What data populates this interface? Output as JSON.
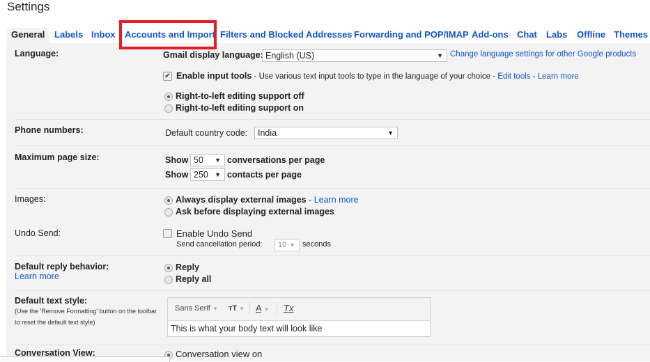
{
  "page": {
    "title": "Settings"
  },
  "tabs": [
    {
      "label": "General",
      "active": true
    },
    {
      "label": "Labels"
    },
    {
      "label": "Inbox"
    },
    {
      "label": "Accounts and Import",
      "highlighted": true
    },
    {
      "label": "Filters and Blocked Addresses"
    },
    {
      "label": "Forwarding and POP/IMAP"
    },
    {
      "label": "Add-ons"
    },
    {
      "label": "Chat"
    },
    {
      "label": "Labs"
    },
    {
      "label": "Offline"
    },
    {
      "label": "Themes"
    }
  ],
  "highlight_color": "#e41c24",
  "language": {
    "label": "Language:",
    "display_language_label": "Gmail display language:",
    "display_language_value": "English (US)",
    "change_link": "Change language settings for other Google products",
    "input_tools_checked": true,
    "input_tools_label": "Enable input tools",
    "input_tools_desc": " - Use various text input tools to type in the language of your choice - ",
    "edit_tools_link": "Edit tools",
    "dash": " - ",
    "learn_more_link": "Learn more",
    "rtl_options": [
      {
        "label": "Right-to-left editing support off",
        "selected": true
      },
      {
        "label": "Right-to-left editing support on",
        "selected": false
      }
    ]
  },
  "phone": {
    "label": "Phone numbers:",
    "country_code_label": "Default country code:",
    "country_code_value": "India"
  },
  "page_size": {
    "label": "Maximum page size:",
    "show_label": "Show",
    "conversations_value": "50",
    "conversations_suffix": "conversations per page",
    "contacts_value": "250",
    "contacts_suffix": "contacts per page"
  },
  "images": {
    "label": "Images:",
    "options": [
      {
        "label": "Always display external images",
        "selected": true
      },
      {
        "label": "Ask before displaying external images",
        "selected": false
      }
    ],
    "learn_more_prefix": " - ",
    "learn_more_link": "Learn more"
  },
  "undo_send": {
    "label": "Undo Send:",
    "checkbox_label": "Enable Undo Send",
    "checked": false,
    "period_label": "Send cancellation period:",
    "period_value": "10",
    "period_suffix": "seconds"
  },
  "reply": {
    "label": "Default reply behavior:",
    "learn_more_link": "Learn more",
    "options": [
      {
        "label": "Reply",
        "selected": true
      },
      {
        "label": "Reply all",
        "selected": false
      }
    ]
  },
  "text_style": {
    "label": "Default text style:",
    "hint_line1": "(Use the 'Remove Formatting' button on the toolbar",
    "hint_line2": "to reset the default text style)",
    "font_value": "Sans Serif",
    "size_icon": "тT",
    "color_icon": "A",
    "remove_format_icon": "Tx",
    "preview_text": "This is what your body text will look like"
  },
  "conversation_view": {
    "label": "Conversation View:",
    "option_on": "Conversation view on",
    "selected": true
  }
}
